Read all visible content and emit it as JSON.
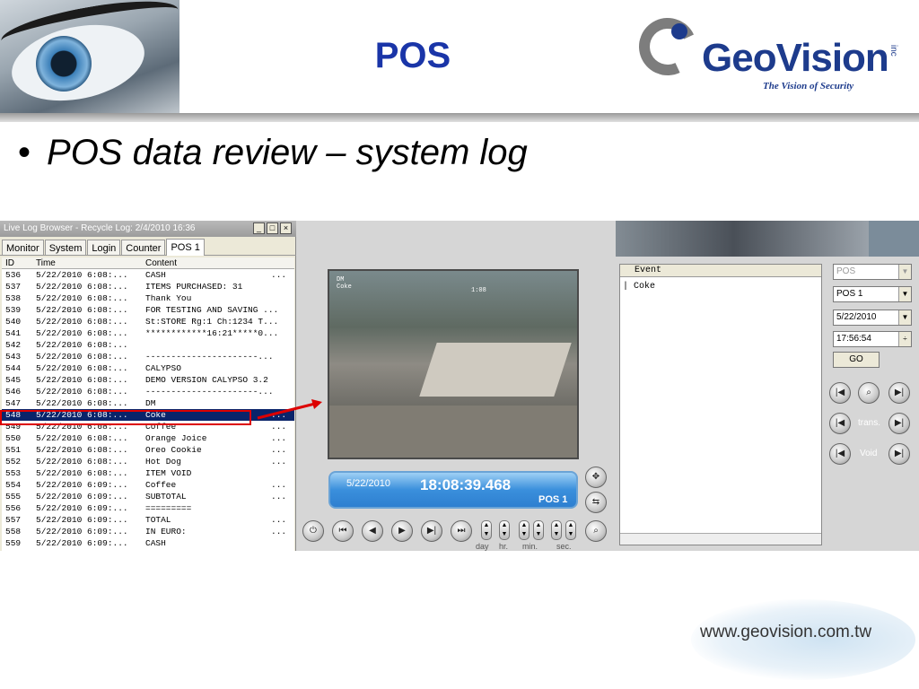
{
  "slide": {
    "title": "POS",
    "bullet": "POS data review – system log",
    "logo_name": "GeoVision",
    "logo_inc": "inc",
    "logo_tagline": "The Vision of Security",
    "website": "www.geovision.com.tw"
  },
  "log_window": {
    "title": "Live Log Browser - Recycle Log: 2/4/2010 16:36",
    "tabs": [
      "Monitor",
      "System",
      "Login",
      "Counter",
      "POS 1"
    ],
    "active_tab": "POS 1",
    "columns": [
      "ID",
      "Time",
      "Content"
    ],
    "rows": [
      {
        "id": "536",
        "time": "5/22/2010 6:08:...",
        "content": "CASH",
        "more": "..."
      },
      {
        "id": "537",
        "time": "5/22/2010 6:08:...",
        "content": "ITEMS PURCHASED: 31",
        "more": ""
      },
      {
        "id": "538",
        "time": "5/22/2010 6:08:...",
        "content": "Thank You",
        "more": ""
      },
      {
        "id": "539",
        "time": "5/22/2010 6:08:...",
        "content": "FOR TESTING AND SAVING ...",
        "more": ""
      },
      {
        "id": "540",
        "time": "5/22/2010 6:08:...",
        "content": "St:STORE Rg:1 Ch:1234 T...",
        "more": ""
      },
      {
        "id": "541",
        "time": "5/22/2010 6:08:...",
        "content": "************16:21*****0...",
        "more": ""
      },
      {
        "id": "542",
        "time": "5/22/2010 6:08:...",
        "content": "",
        "more": ""
      },
      {
        "id": "543",
        "time": "5/22/2010 6:08:...",
        "content": "----------------------...",
        "more": ""
      },
      {
        "id": "544",
        "time": "5/22/2010 6:08:...",
        "content": "CALYPSO",
        "more": ""
      },
      {
        "id": "545",
        "time": "5/22/2010 6:08:...",
        "content": "DEMO VERSION CALYPSO 3.2",
        "more": ""
      },
      {
        "id": "546",
        "time": "5/22/2010 6:08:...",
        "content": "----------------------...",
        "more": ""
      },
      {
        "id": "547",
        "time": "5/22/2010 6:08:...",
        "content": "DM",
        "more": ""
      },
      {
        "id": "548",
        "time": "5/22/2010 6:08:...",
        "content": "Coke",
        "more": "..."
      },
      {
        "id": "549",
        "time": "5/22/2010 6:08:...",
        "content": "Coffee",
        "more": "..."
      },
      {
        "id": "550",
        "time": "5/22/2010 6:08:...",
        "content": "Orange Joice",
        "more": "..."
      },
      {
        "id": "551",
        "time": "5/22/2010 6:08:...",
        "content": "Oreo Cookie",
        "more": "..."
      },
      {
        "id": "552",
        "time": "5/22/2010 6:08:...",
        "content": "Hot Dog",
        "more": "..."
      },
      {
        "id": "553",
        "time": "5/22/2010 6:08:...",
        "content": "ITEM VOID",
        "more": ""
      },
      {
        "id": "554",
        "time": "5/22/2010 6:09:...",
        "content": "Coffee",
        "more": "..."
      },
      {
        "id": "555",
        "time": "5/22/2010 6:09:...",
        "content": "SUBTOTAL",
        "more": "..."
      },
      {
        "id": "556",
        "time": "5/22/2010 6:09:...",
        "content": "=========",
        "more": ""
      },
      {
        "id": "557",
        "time": "5/22/2010 6:09:...",
        "content": "TOTAL",
        "more": "..."
      },
      {
        "id": "558",
        "time": "5/22/2010 6:09:...",
        "content": "IN EURO:",
        "more": "..."
      },
      {
        "id": "559",
        "time": "5/22/2010 6:09:...",
        "content": "CASH",
        "more": ""
      }
    ],
    "selected_id": "548"
  },
  "player": {
    "cam_overlay_left": "DM\nCoke",
    "cam_overlay_time": "1:08",
    "date": "5/22/2010",
    "time": "18:08:39.468",
    "pos": "POS 1",
    "spin_labels": [
      "day",
      "hr.",
      "min.",
      "sec."
    ]
  },
  "event_panel": {
    "header": "Event",
    "rows": [
      "Coke"
    ]
  },
  "controls": {
    "source": "POS",
    "pos_select": "POS 1",
    "date": "5/22/2010",
    "time": "17:56:54",
    "go_label": "GO",
    "trans_label": "trans.",
    "void_label": "Void"
  }
}
